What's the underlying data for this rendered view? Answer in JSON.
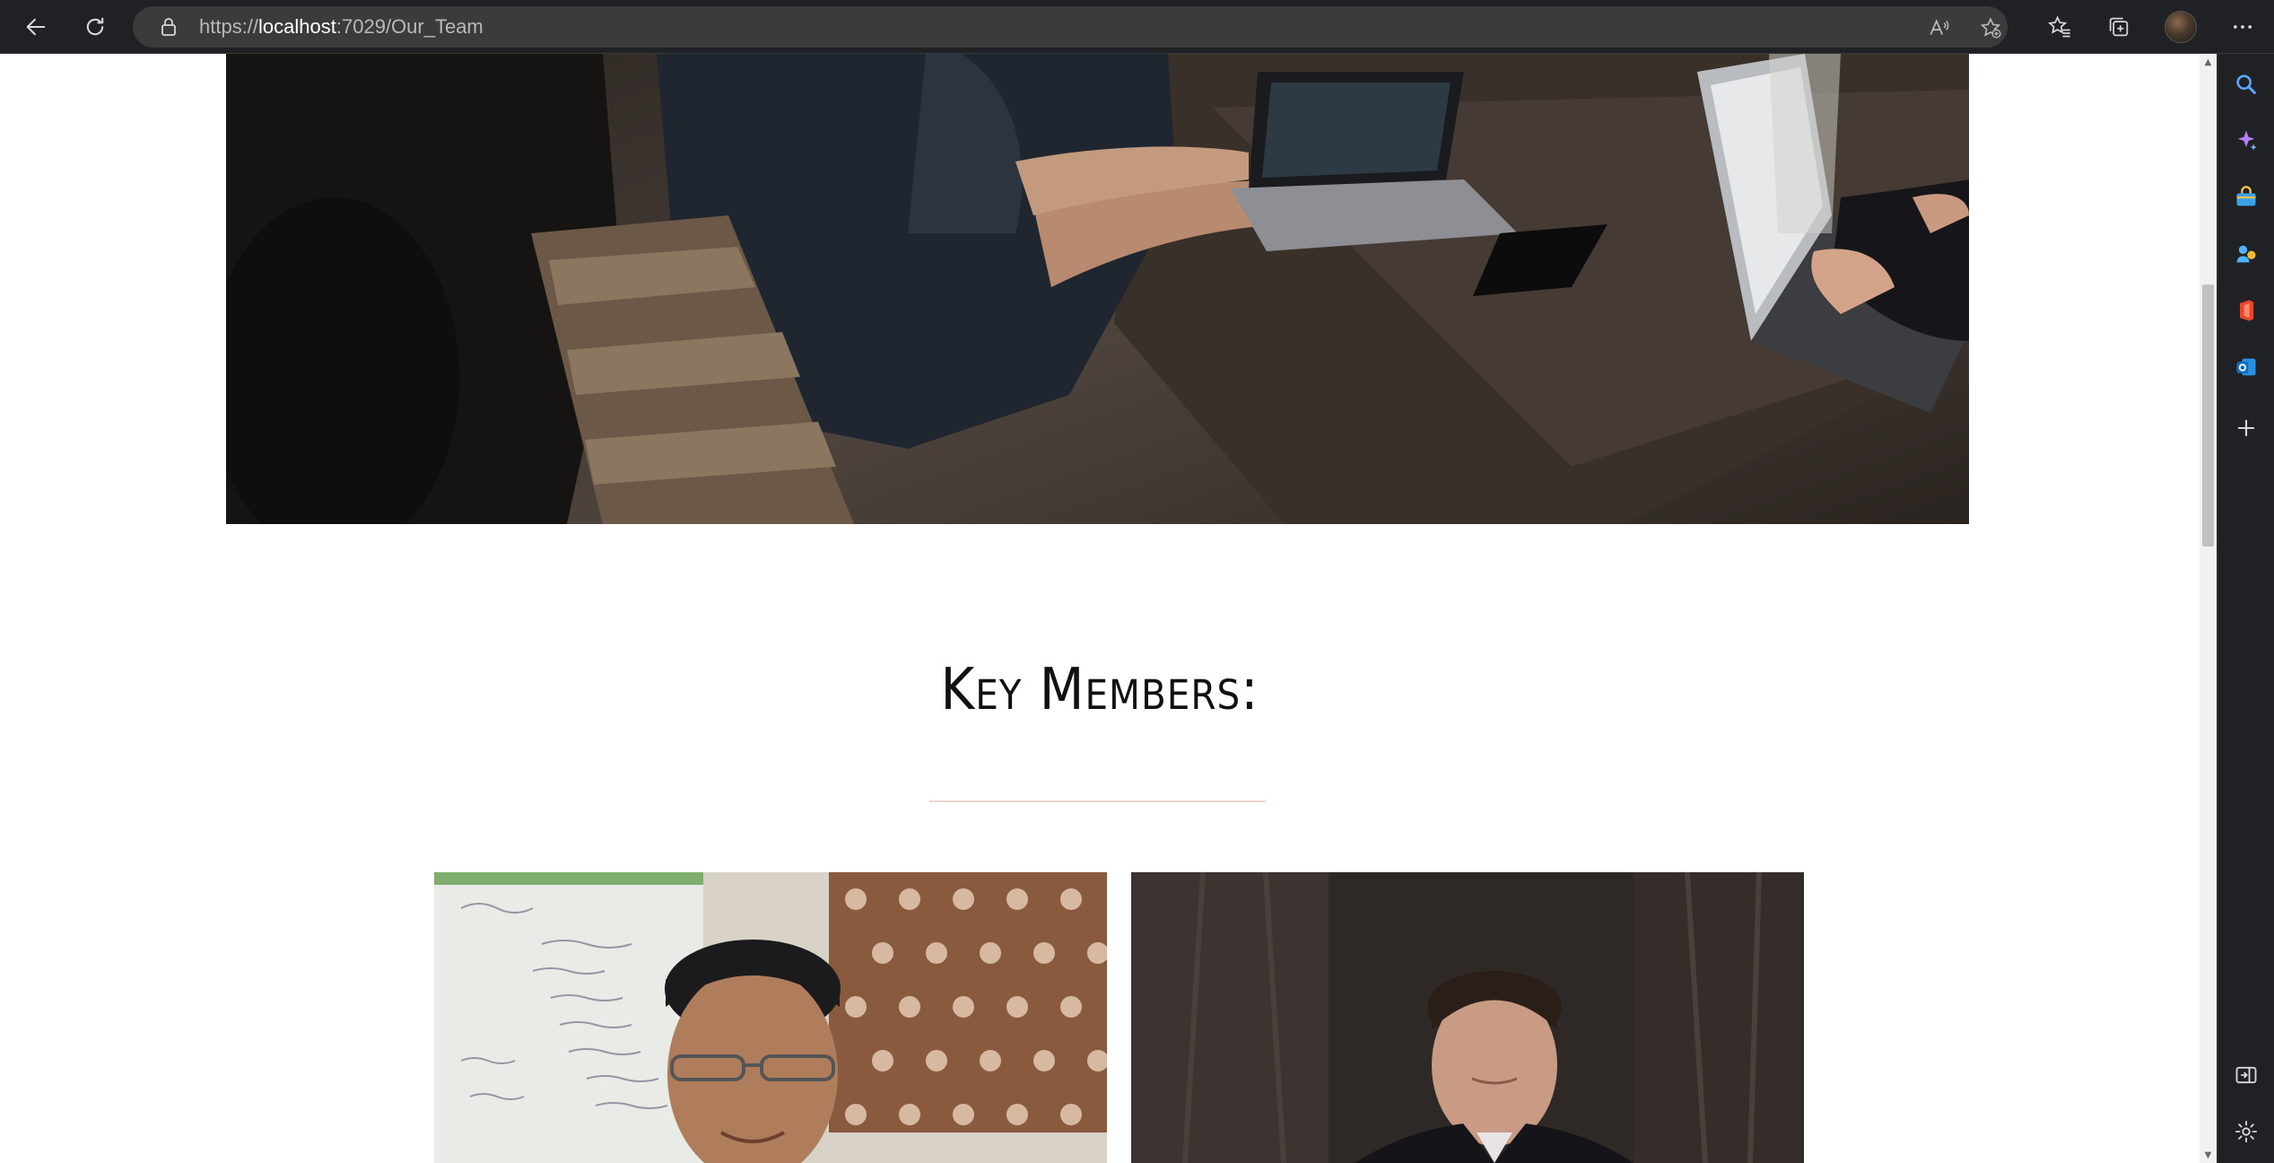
{
  "browser": {
    "url_scheme": "https://",
    "url_host": "localhost",
    "url_path": ":7029/Our_Team",
    "accent": "#202124"
  },
  "toolbar": {
    "back_icon": "back-arrow-icon",
    "refresh_icon": "refresh-icon",
    "lock_icon": "lock-icon",
    "read_aloud_icon": "read-aloud-icon",
    "add_favorite_icon": "add-favorite-icon",
    "favorites_icon": "favorites-icon",
    "collections_icon": "collections-icon",
    "menu_icon": "more-options-icon"
  },
  "page": {
    "section_title": "Key Members:",
    "divider_color": "#f0d4d4",
    "hero_image": "team working on laptops at wooden table",
    "members": [
      {
        "photo": "young man with glasses in front of carved wooden screen"
      },
      {
        "photo": "man in dark suit against dark background"
      }
    ]
  },
  "sidebar": {
    "items": [
      "search-icon",
      "copilot-icon",
      "shopping-icon",
      "games-icon",
      "office-icon",
      "outlook-icon",
      "add-icon",
      "hide-sidebar-icon",
      "settings-icon"
    ]
  }
}
